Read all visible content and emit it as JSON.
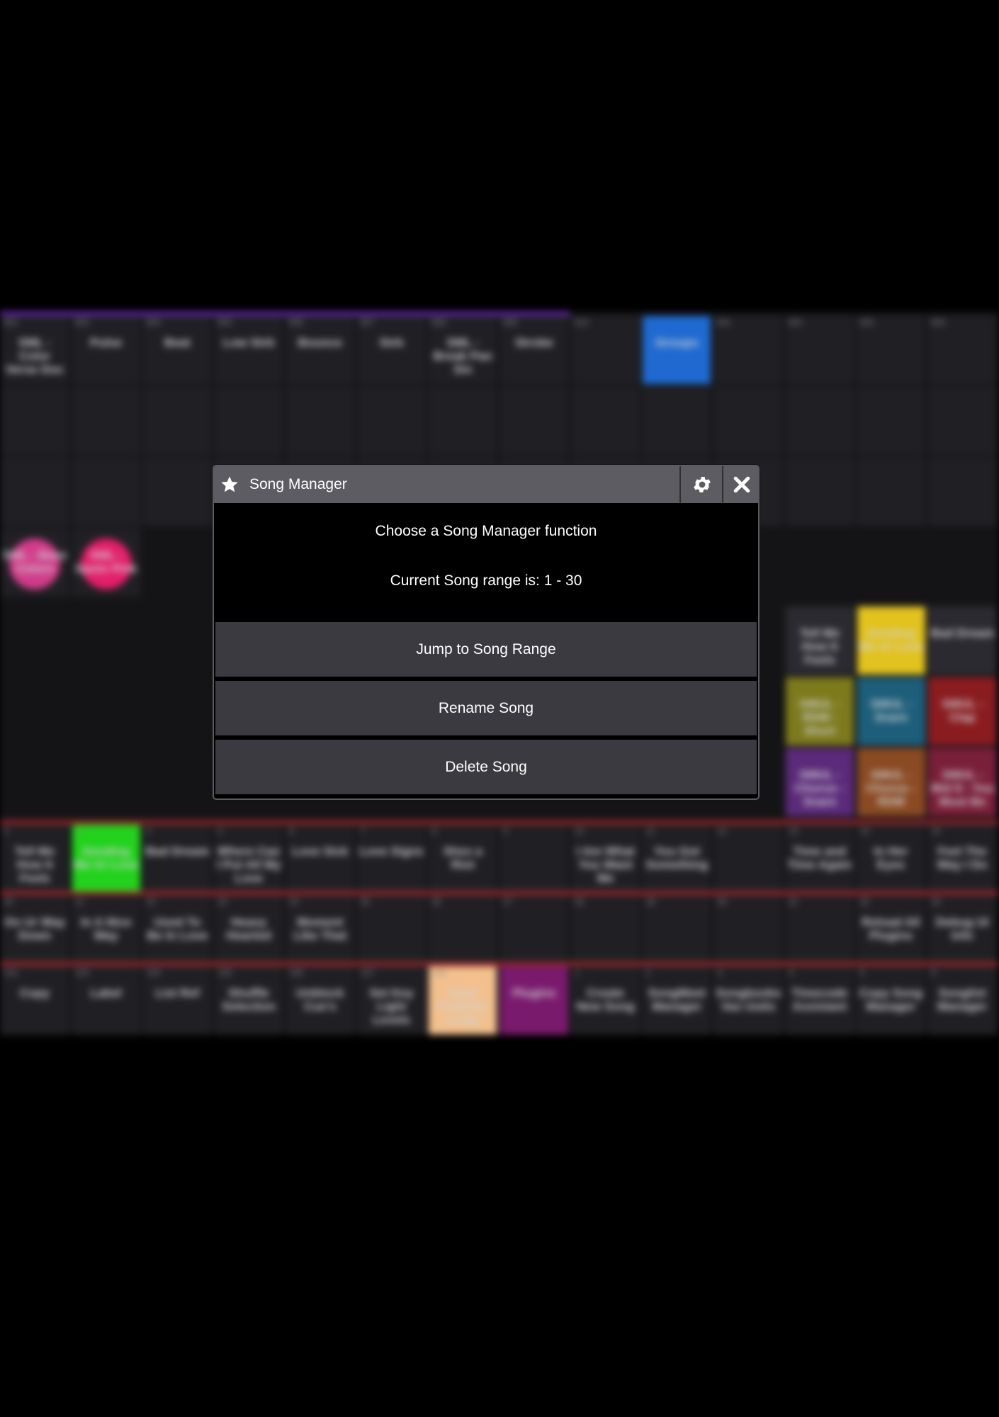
{
  "dialog": {
    "title": "Song Manager",
    "title_icon": "star-icon",
    "settings_icon": "gear-icon",
    "close_icon": "close-icon",
    "heading": "Choose a Song Manager function",
    "range_text": "Current Song range is: 1 - 30",
    "actions": [
      "Jump to Song Range",
      "Rename Song",
      "Delete Song"
    ]
  },
  "background": {
    "row_top": {
      "numbers": [
        "602",
        "603",
        "604",
        "605",
        "606",
        "607",
        "608",
        "609",
        "610",
        "",
        "601",
        "602",
        "603",
        "604"
      ],
      "labels": [
        "SML - Color Verse Doc",
        "Pulse",
        "Beat",
        "Low Strb",
        "Bounce",
        "Strb",
        "SML - Break Pan Sin",
        "Strobe",
        "",
        "Groups",
        "",
        "",
        "",
        ""
      ]
    },
    "row_songs_a": {
      "numbers": [
        "2",
        "3",
        "4",
        "5",
        "6",
        "7",
        "8",
        "9",
        "10",
        "11",
        "12",
        "13",
        "14",
        "15"
      ],
      "labels": [
        "Tell Me How It Feels",
        "Sending Me Ur Love",
        "Bad Dream",
        "Where Can I Put All My Love",
        "Love Sick",
        "Love Signs",
        "Shes a Riot",
        "",
        "I Am What You Want Me",
        "You Got Something",
        "",
        "Time and Time Again",
        "In Her Eyes",
        "Feel The Way I Do"
      ]
    },
    "row_songs_b": {
      "numbers": [
        "20",
        "21",
        "22",
        "23",
        "24",
        "25",
        "26",
        "27",
        "28",
        "29",
        "30",
        "31",
        "32",
        "33"
      ],
      "labels": [
        "On Ur Way Down",
        "In A Nice Way",
        "Used To Be In Love",
        "Heavy Hearted",
        "Moment Like That",
        "",
        "",
        "",
        "",
        "",
        "",
        "",
        "Reload All Plugins",
        "Debug UI Info"
      ]
    },
    "row_macros": {
      "numbers": [
        "102",
        "103",
        "104",
        "105",
        "106",
        "107",
        "108",
        "",
        "1",
        "2",
        "3",
        "4",
        "5",
        "6"
      ],
      "labels": [
        "Copy",
        "Label",
        "List Ref",
        "Shuffle Selection",
        "Unblock Cue's",
        "Set Key Light Levels",
        "Steal Pollarity Lordy",
        "Plugins",
        "Create New Song",
        "SongMeet Manager",
        "Songbooks Vas Uutis",
        "Timecode Assistant",
        "Copy Song Manager",
        "Songlist Manager"
      ]
    },
    "right_panel": {
      "row1": [
        "Tell Me How It Feels",
        "Sending Me Ur Love",
        "Bad Dream"
      ],
      "row2": [
        "SMUL - RDM - Short",
        "SMUL - Snare",
        "SMUL - Clap"
      ],
      "row3": [
        "SMUL - Chorus - Snare",
        "SMUL - Chorus - RDM",
        "SMUL - Mid 8 - You Must Be"
      ]
    },
    "left_bubbles": [
      "SML - Base Colors",
      "SML - Spots Pink"
    ]
  },
  "colors": {
    "purple_strip": "#7b2bd1",
    "red_strip": "#b3282d",
    "groups_blue": "#1f6ad1",
    "selected_green": "#22d21c",
    "selected_yellow": "#e2c21e",
    "peach": "#f3c08d",
    "plugins_magenta": "#7a1a6d"
  }
}
